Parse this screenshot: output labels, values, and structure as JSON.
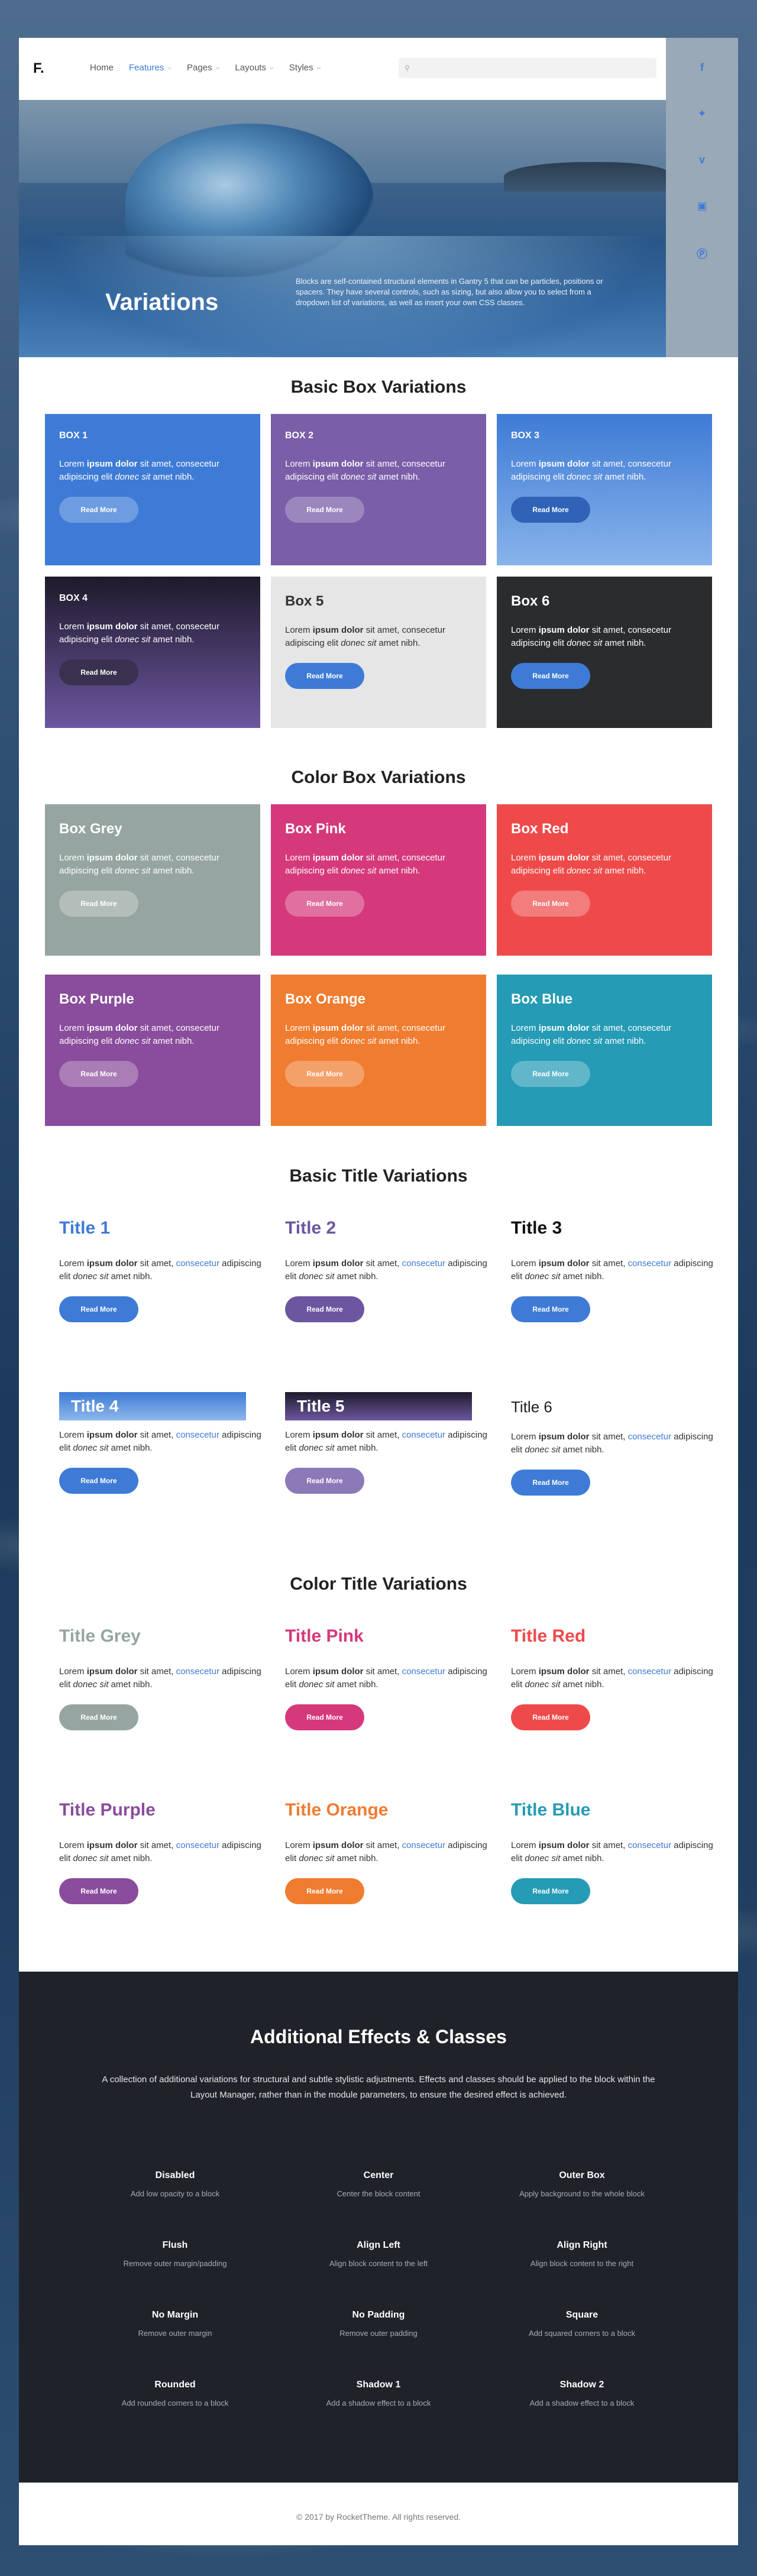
{
  "brand": {
    "logo": "F."
  },
  "nav": {
    "items": [
      {
        "label": "Home",
        "caret": false,
        "active": false
      },
      {
        "label": "Features",
        "caret": true,
        "active": true
      },
      {
        "label": "Pages",
        "caret": true,
        "active": false
      },
      {
        "label": "Layouts",
        "caret": true,
        "active": false
      },
      {
        "label": "Styles",
        "caret": true,
        "active": false
      }
    ]
  },
  "social": [
    "facebook-icon",
    "twitter-icon",
    "vimeo-icon",
    "instagram-icon",
    "pinterest-icon"
  ],
  "hero": {
    "title": "Variations",
    "text": "Blocks are self-contained structural elements in Gantry 5 that can be particles, positions or spacers. They have several controls, such as sizing, but also allow you to select from a dropdown list of variations, as well as insert your own CSS classes."
  },
  "lorem": {
    "a": "Lorem ",
    "b": "ipsum dolor",
    "c": " sit amet, ",
    "d": "consecetur",
    "e": " adipiscing elit ",
    "f": "donec sit",
    "g": " amet nibh."
  },
  "read_more": "Read More",
  "basic_box": {
    "heading": "Basic Box Variations",
    "boxes": [
      {
        "title": "BOX 1"
      },
      {
        "title": "BOX 2"
      },
      {
        "title": "BOX 3"
      },
      {
        "title": "BOX 4"
      },
      {
        "title": "Box 5"
      },
      {
        "title": "Box 6"
      }
    ]
  },
  "color_box": {
    "heading": "Color Box Variations",
    "boxes": [
      {
        "title": "Box Grey"
      },
      {
        "title": "Box Pink"
      },
      {
        "title": "Box Red"
      },
      {
        "title": "Box Purple"
      },
      {
        "title": "Box Orange"
      },
      {
        "title": "Box Blue"
      }
    ]
  },
  "basic_title": {
    "heading": "Basic Title Variations",
    "items": [
      {
        "title": "Title 1"
      },
      {
        "title": "Title 2"
      },
      {
        "title": "Title 3"
      },
      {
        "title": "Title 4"
      },
      {
        "title": "Title 5"
      },
      {
        "title": "Title 6"
      }
    ]
  },
  "color_title": {
    "heading": "Color Title Variations",
    "items": [
      {
        "title": "Title Grey"
      },
      {
        "title": "Title Pink"
      },
      {
        "title": "Title Red"
      },
      {
        "title": "Title Purple"
      },
      {
        "title": "Title Orange"
      },
      {
        "title": "Title Blue"
      }
    ]
  },
  "effects": {
    "heading": "Additional Effects & Classes",
    "lead": "A collection of additional variations for structural and subtle stylistic adjustments. Effects and classes should be applied to the block within the Layout Manager, rather than in the module parameters, to ensure the desired effect is achieved.",
    "items": [
      {
        "title": "Disabled",
        "desc": "Add low opacity to a block"
      },
      {
        "title": "Center",
        "desc": "Center the block content"
      },
      {
        "title": "Outer Box",
        "desc": "Apply background to the whole block"
      },
      {
        "title": "Flush",
        "desc": "Remove outer margin/padding"
      },
      {
        "title": "Align Left",
        "desc": "Align block content to the left"
      },
      {
        "title": "Align Right",
        "desc": "Align block content to the right"
      },
      {
        "title": "No Margin",
        "desc": "Remove outer margin"
      },
      {
        "title": "No Padding",
        "desc": "Remove outer padding"
      },
      {
        "title": "Square",
        "desc": "Add squared corners to a block"
      },
      {
        "title": "Rounded",
        "desc": "Add rounded corners to a block"
      },
      {
        "title": "Shadow 1",
        "desc": "Add a shadow effect to a block"
      },
      {
        "title": "Shadow 2",
        "desc": "Add a shadow effect to a block"
      }
    ]
  },
  "footer": {
    "copyright": "© 2017 by RocketTheme. All rights reserved."
  },
  "colors": {
    "accent": "#3e7bd6",
    "grey": "#96a5a1",
    "pink": "#d5397b",
    "red": "#ef4a4a",
    "purple": "#8a4c9c",
    "orange": "#f07c30",
    "blue": "#259bb5"
  }
}
